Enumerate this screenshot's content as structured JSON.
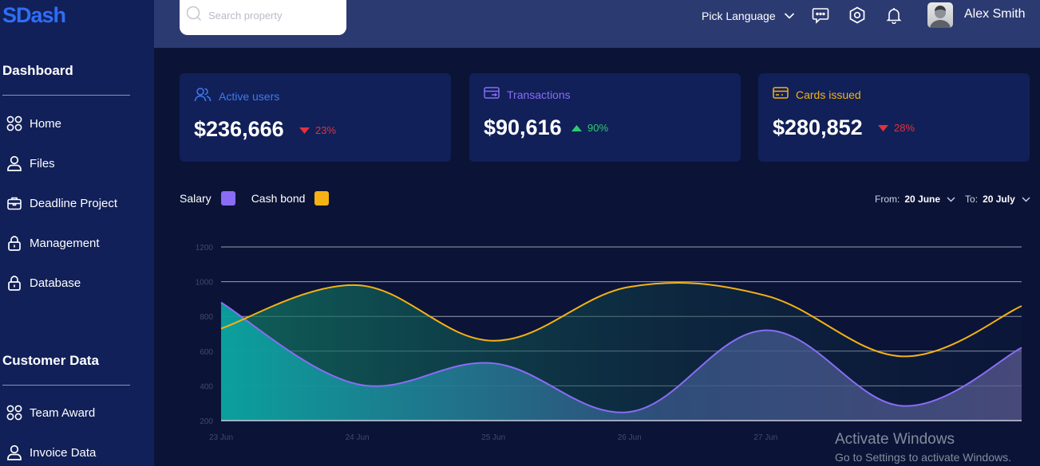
{
  "app": {
    "logo": "SDash"
  },
  "sidebar": {
    "sections": [
      {
        "title": "Dashboard",
        "items": [
          {
            "label": "Home",
            "icon": "grid-icon"
          },
          {
            "label": "Files",
            "icon": "user-icon"
          },
          {
            "label": "Deadline Project",
            "icon": "briefcase-icon"
          },
          {
            "label": "Management",
            "icon": "lock-icon"
          },
          {
            "label": "Database",
            "icon": "lock-icon"
          }
        ]
      },
      {
        "title": "Customer Data",
        "items": [
          {
            "label": "Team Award",
            "icon": "grid-icon"
          },
          {
            "label": "Invoice Data",
            "icon": "user-icon"
          }
        ]
      }
    ]
  },
  "topbar": {
    "search_placeholder": "Search property",
    "language_label": "Pick Language",
    "user_name": "Alex Smith"
  },
  "cards": [
    {
      "title": "Active users",
      "value": "$236,666",
      "change": "23%",
      "direction": "down",
      "accent": "#3f79f5",
      "change_color": "#e2323d",
      "icon": "users-icon"
    },
    {
      "title": "Transactions",
      "value": "$90,616",
      "change": "90%",
      "direction": "up",
      "accent": "#8a6cf6",
      "change_color": "#2ecc71",
      "icon": "card-transfer-icon"
    },
    {
      "title": "Cards issued",
      "value": "$280,852",
      "change": "28%",
      "direction": "down",
      "accent": "#f5b214",
      "change_color": "#e2323d",
      "icon": "credit-card-icon"
    }
  ],
  "legend": [
    {
      "label": "Salary",
      "color": "#8a6cf6"
    },
    {
      "label": "Cash bond",
      "color": "#f5b214"
    }
  ],
  "range": {
    "from_label": "From:",
    "from_value": "20 June",
    "to_label": "To:",
    "to_value": "20 July"
  },
  "chart_data": {
    "type": "area",
    "categories": [
      "23 Jun",
      "24 Jun",
      "25 Jun",
      "26 Jun",
      "27 Jun",
      "",
      ""
    ],
    "ylim": [
      200,
      1200
    ],
    "yticks": [
      "1200",
      "1000",
      "800",
      "600",
      "400",
      "200"
    ],
    "grid": true,
    "series": [
      {
        "name": "Salary",
        "color": "#8a6cf6",
        "values": [
          880,
          410,
          530,
          250,
          720,
          285,
          620
        ]
      },
      {
        "name": "Cash bond",
        "color": "#f5b214",
        "values": [
          730,
          980,
          660,
          970,
          920,
          570,
          860
        ]
      }
    ]
  },
  "watermark": {
    "line1": "Activate Windows",
    "line2": "Go to Settings to activate Windows."
  }
}
